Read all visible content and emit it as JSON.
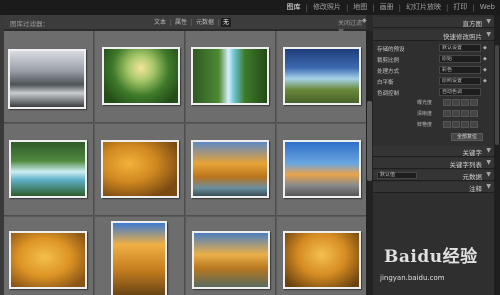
{
  "modules": [
    "图库",
    "修改照片",
    "地图",
    "画册",
    "幻灯片放映",
    "打印",
    "Web"
  ],
  "filter_bar": {
    "title": "图库过滤器：",
    "options": [
      "文本",
      "属性",
      "元数据",
      "无"
    ],
    "active_option": "无",
    "off_label": "关闭过滤器"
  },
  "right_panel": {
    "histogram_label": "直方图",
    "quick_develop_label": "快速修改照片",
    "saved_preset_label": "存储的预设",
    "saved_preset_value": "默认设置",
    "crop_label": "裁剪比例",
    "crop_value": "原始",
    "treatment_label": "处理方式",
    "treatment_value": "彩色",
    "white_balance_label": "白平衡",
    "white_balance_value": "原照设置",
    "tone_control_label": "色调控制",
    "auto_tone_label": "自动色调",
    "exposure_label": "曝光度",
    "clarity_label": "清晰度",
    "vibrance_label": "鲜艳度",
    "reset_label": "全部复位",
    "keywording_label": "关键字",
    "keyword_list_label": "关键字列表",
    "metadata_preset_value": "默认值",
    "metadata_label": "元数据",
    "comments_label": "注释"
  },
  "watermark": {
    "brand": "Baidu经验",
    "url": "jingyan.baidu.com"
  },
  "icons": {
    "panel_triangle": "▼",
    "dropdown_arrow": "◆"
  },
  "colors": {
    "module_active": "#f2f2f2",
    "grid_cell": "#6d6d6d",
    "grid_background": "#5a5a5a",
    "panel_background": "#2f2f2f",
    "thumb_border": "#efefef"
  }
}
